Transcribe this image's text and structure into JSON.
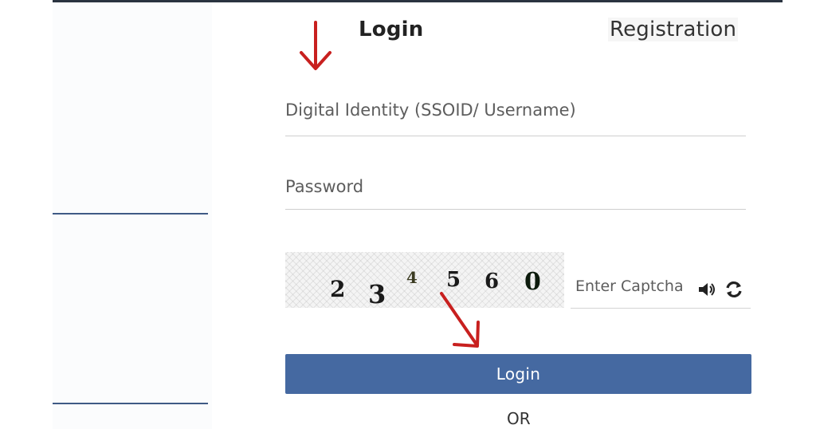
{
  "tabs": {
    "login_label": "Login",
    "registration_label": "Registration"
  },
  "form": {
    "username_placeholder": "Digital Identity (SSOID/ Username)",
    "password_placeholder": "Password",
    "captcha_digits": [
      "2",
      "3",
      "4",
      "5",
      "6",
      "0"
    ],
    "captcha_placeholder": "Enter Captcha",
    "login_button_label": "Login",
    "or_text": "OR"
  },
  "icons": {
    "audio": "speaker-icon",
    "refresh": "refresh-icon",
    "annotation": "red-arrow-icon"
  },
  "colors": {
    "button": "#4569a1",
    "annotation_arrow": "#c8201f",
    "left_rule": "#3f5a85"
  }
}
